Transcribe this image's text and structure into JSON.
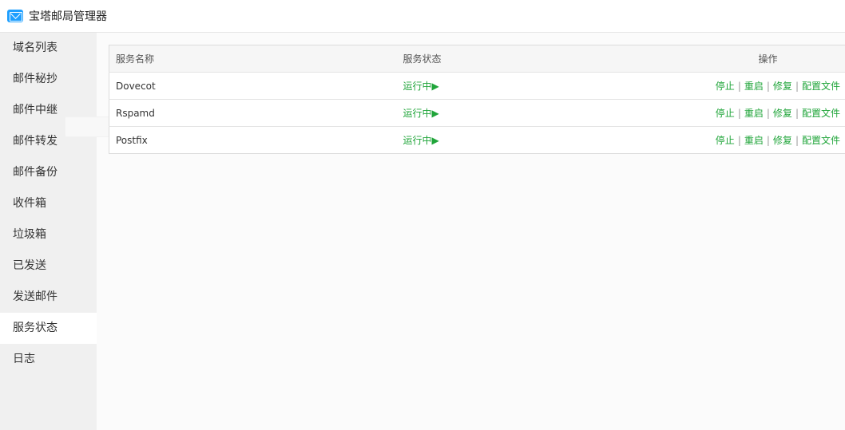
{
  "app": {
    "title": "宝塔邮局管理器",
    "icon": "mail-icon"
  },
  "sidebar": {
    "items": [
      {
        "label": "域名列表"
      },
      {
        "label": "邮件秘抄"
      },
      {
        "label": "邮件中继"
      },
      {
        "label": "邮件转发"
      },
      {
        "label": "邮件备份"
      },
      {
        "label": "收件箱"
      },
      {
        "label": "垃圾箱"
      },
      {
        "label": "已发送"
      },
      {
        "label": "发送邮件"
      },
      {
        "label": "服务状态",
        "active": true
      },
      {
        "label": "日志"
      }
    ]
  },
  "service_table": {
    "headers": {
      "name": "服务名称",
      "status": "服务状态",
      "ops": "操作"
    },
    "rows": [
      {
        "name": "Dovecot",
        "status": "运行中▶"
      },
      {
        "name": "Rspamd",
        "status": "运行中▶"
      },
      {
        "name": "Postfix",
        "status": "运行中▶"
      }
    ],
    "actions": {
      "stop": "停止",
      "restart": "重启",
      "repair": "修复",
      "config": "配置文件",
      "separator": "|"
    }
  },
  "colors": {
    "accent_green": "#20a53a",
    "sidebar_bg": "#f0f0f0",
    "active_item_bg": "#ffffff",
    "icon_blue": "#1e9fff"
  }
}
